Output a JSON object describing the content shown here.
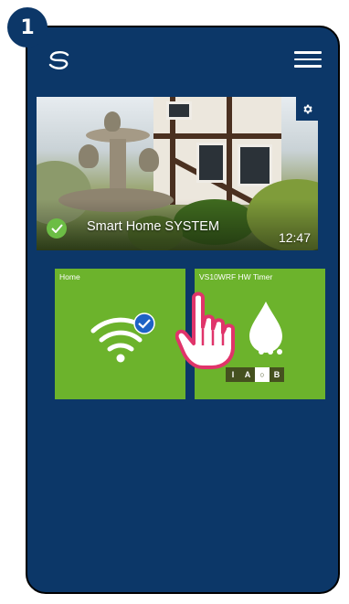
{
  "step": {
    "number": "1"
  },
  "app": {
    "logo": "salus-s-icon",
    "menu": "hamburger-menu-icon",
    "background_color": "#0c3768"
  },
  "hero": {
    "title": "Smart Home SYSTEM",
    "time": "12:47",
    "status_icon": "check-circle-icon",
    "settings_icon": "gear-icon"
  },
  "tiles": [
    {
      "label": "Home",
      "icon": "wifi-icon",
      "status": "connected-check-icon"
    },
    {
      "label": "VS10WRF HW Timer",
      "icon": "water-drop-icon",
      "modes": [
        {
          "label": "I",
          "active": false
        },
        {
          "label": "A",
          "active": false
        },
        {
          "label": "○",
          "active": true
        },
        {
          "label": "B",
          "active": false
        }
      ]
    }
  ],
  "colors": {
    "tile_green": "#6cb32c",
    "check_green": "#6cbd45",
    "pointer_pink": "#e0346a"
  }
}
